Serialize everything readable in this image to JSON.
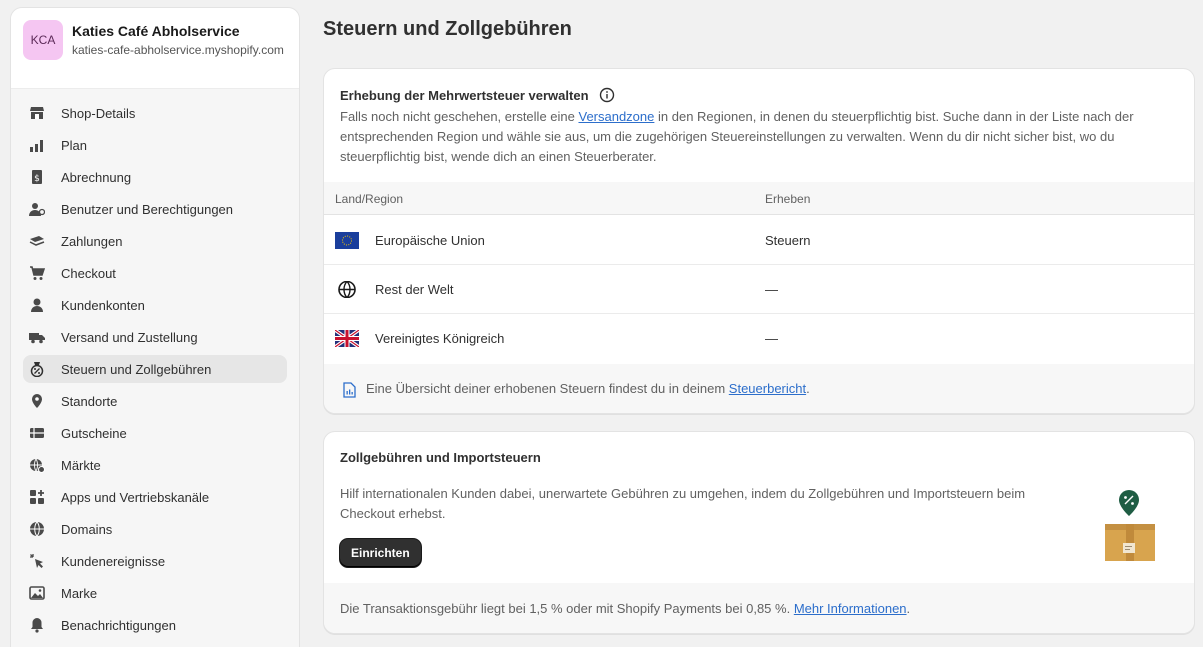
{
  "store": {
    "initials": "KCA",
    "name": "Katies Café Abholservice",
    "domain": "katies-cafe-abholservice.myshopify.com"
  },
  "nav": [
    {
      "label": "Shop-Details",
      "icon": "store-icon"
    },
    {
      "label": "Plan",
      "icon": "plan-icon"
    },
    {
      "label": "Abrechnung",
      "icon": "billing-icon"
    },
    {
      "label": "Benutzer und Berechtigungen",
      "icon": "users-icon"
    },
    {
      "label": "Zahlungen",
      "icon": "payments-icon"
    },
    {
      "label": "Checkout",
      "icon": "cart-icon"
    },
    {
      "label": "Kundenkonten",
      "icon": "person-icon"
    },
    {
      "label": "Versand und Zustellung",
      "icon": "truck-icon"
    },
    {
      "label": "Steuern und Zollgebühren",
      "icon": "tax-icon",
      "active": true
    },
    {
      "label": "Standorte",
      "icon": "location-icon"
    },
    {
      "label": "Gutscheine",
      "icon": "gift-card-icon"
    },
    {
      "label": "Märkte",
      "icon": "globe-market-icon"
    },
    {
      "label": "Apps und Vertriebskanäle",
      "icon": "apps-icon"
    },
    {
      "label": "Domains",
      "icon": "globe-icon"
    },
    {
      "label": "Kundenereignisse",
      "icon": "cursor-icon"
    },
    {
      "label": "Marke",
      "icon": "image-icon"
    },
    {
      "label": "Benachrichtigungen",
      "icon": "bell-icon"
    }
  ],
  "page": {
    "title": "Steuern und Zollgebühren"
  },
  "vat_card": {
    "title": "Erhebung der Mehrwertsteuer verwalten",
    "desc_before": "Falls noch nicht geschehen, erstelle eine ",
    "desc_link": "Versandzone",
    "desc_after": " in den Regionen, in denen du steuerpflichtig bist. Suche dann in der Liste nach der entsprechenden Region und wähle sie aus, um die zugehörigen Steuereinstellungen zu verwalten. Wenn du dir nicht sicher bist, wo du steuerpflichtig bist, wende dich an einen Steuerberater.",
    "col_region": "Land/Region",
    "col_collect": "Erheben",
    "rows": [
      {
        "flag": "eu-flag-icon",
        "name": "Europäische Union",
        "value": "Steuern"
      },
      {
        "flag": "globe-icon",
        "name": "Rest der Welt",
        "value": "—"
      },
      {
        "flag": "uk-flag-icon",
        "name": "Vereinigtes Königreich",
        "value": "—"
      }
    ],
    "footer_before": "Eine Übersicht deiner erhobenen Steuern findest du in deinem ",
    "footer_link": "Steuerbericht",
    "footer_after": "."
  },
  "duties_card": {
    "title": "Zollgebühren und Importsteuern",
    "desc": "Hilf internationalen Kunden dabei, unerwartete Gebühren zu umgehen, indem du Zollgebühren und Importsteuern beim Checkout erhebst.",
    "button": "Einrichten",
    "footer_before": "Die Transaktionsgebühr liegt bei 1,5 % oder mit Shopify Payments bei 0,85 %. ",
    "footer_link": "Mehr Informationen",
    "footer_after": "."
  }
}
